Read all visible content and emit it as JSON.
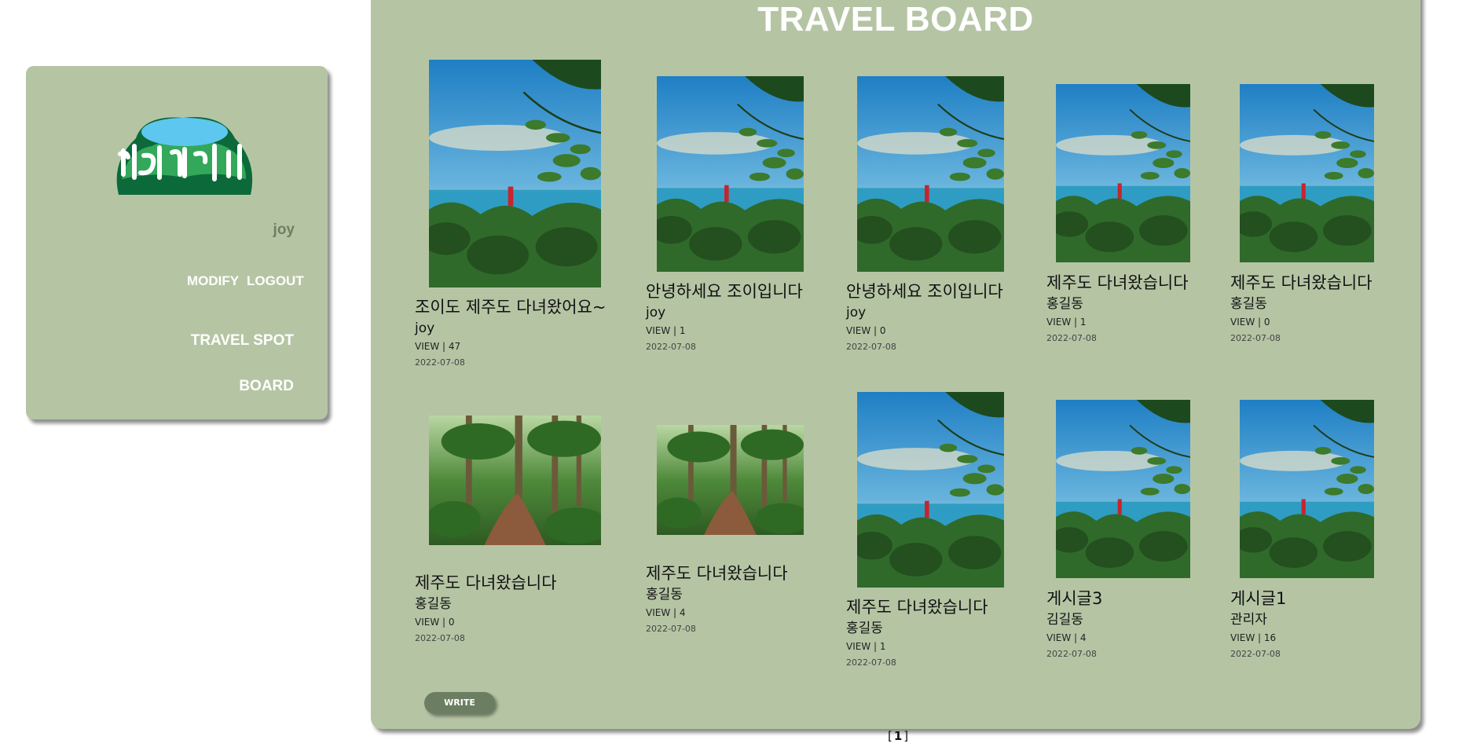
{
  "sidebar": {
    "username": "joy",
    "modify": "MODIFY",
    "logout": "LOGOUT",
    "travel_spot": "TRAVEL SPOT",
    "board": "BOARD"
  },
  "board": {
    "title": "TRAVEL BOARD",
    "write": "WRITE",
    "pagination": {
      "open": "[",
      "page": "1",
      "close": "]"
    },
    "posts": [
      {
        "title": "조이도 제주도 다녀왔어요~",
        "author": "joy",
        "views": "VIEW | 47",
        "date": "2022-07-08",
        "image": "sea-lighthouse"
      },
      {
        "title": "안녕하세요 조이입니다",
        "author": "joy",
        "views": "VIEW | 1",
        "date": "2022-07-08",
        "image": "sea-lighthouse"
      },
      {
        "title": "안녕하세요 조이입니다",
        "author": "joy",
        "views": "VIEW | 0",
        "date": "2022-07-08",
        "image": "sea-lighthouse"
      },
      {
        "title": "제주도 다녀왔습니다",
        "author": "홍길동",
        "views": "VIEW | 1",
        "date": "2022-07-08",
        "image": "sea-lighthouse"
      },
      {
        "title": "제주도 다녀왔습니다",
        "author": "홍길동",
        "views": "VIEW | 0",
        "date": "2022-07-08",
        "image": "sea-lighthouse"
      },
      {
        "title": "제주도 다녀왔습니다",
        "author": "홍길동",
        "views": "VIEW | 0",
        "date": "2022-07-08",
        "image": "forest-path"
      },
      {
        "title": "제주도 다녀왔습니다",
        "author": "홍길동",
        "views": "VIEW | 4",
        "date": "2022-07-08",
        "image": "forest-path"
      },
      {
        "title": "제주도 다녀왔습니다",
        "author": "홍길동",
        "views": "VIEW | 1",
        "date": "2022-07-08",
        "image": "sea-lighthouse"
      },
      {
        "title": "게시글3",
        "author": "김길동",
        "views": "VIEW | 4",
        "date": "2022-07-08",
        "image": "sea-lighthouse"
      },
      {
        "title": "게시글1",
        "author": "관리자",
        "views": "VIEW | 16",
        "date": "2022-07-08",
        "image": "sea-lighthouse"
      }
    ]
  },
  "colors": {
    "panel": "#b5c5a4",
    "button": "#6b7e62",
    "text_light": "#ffffff"
  }
}
